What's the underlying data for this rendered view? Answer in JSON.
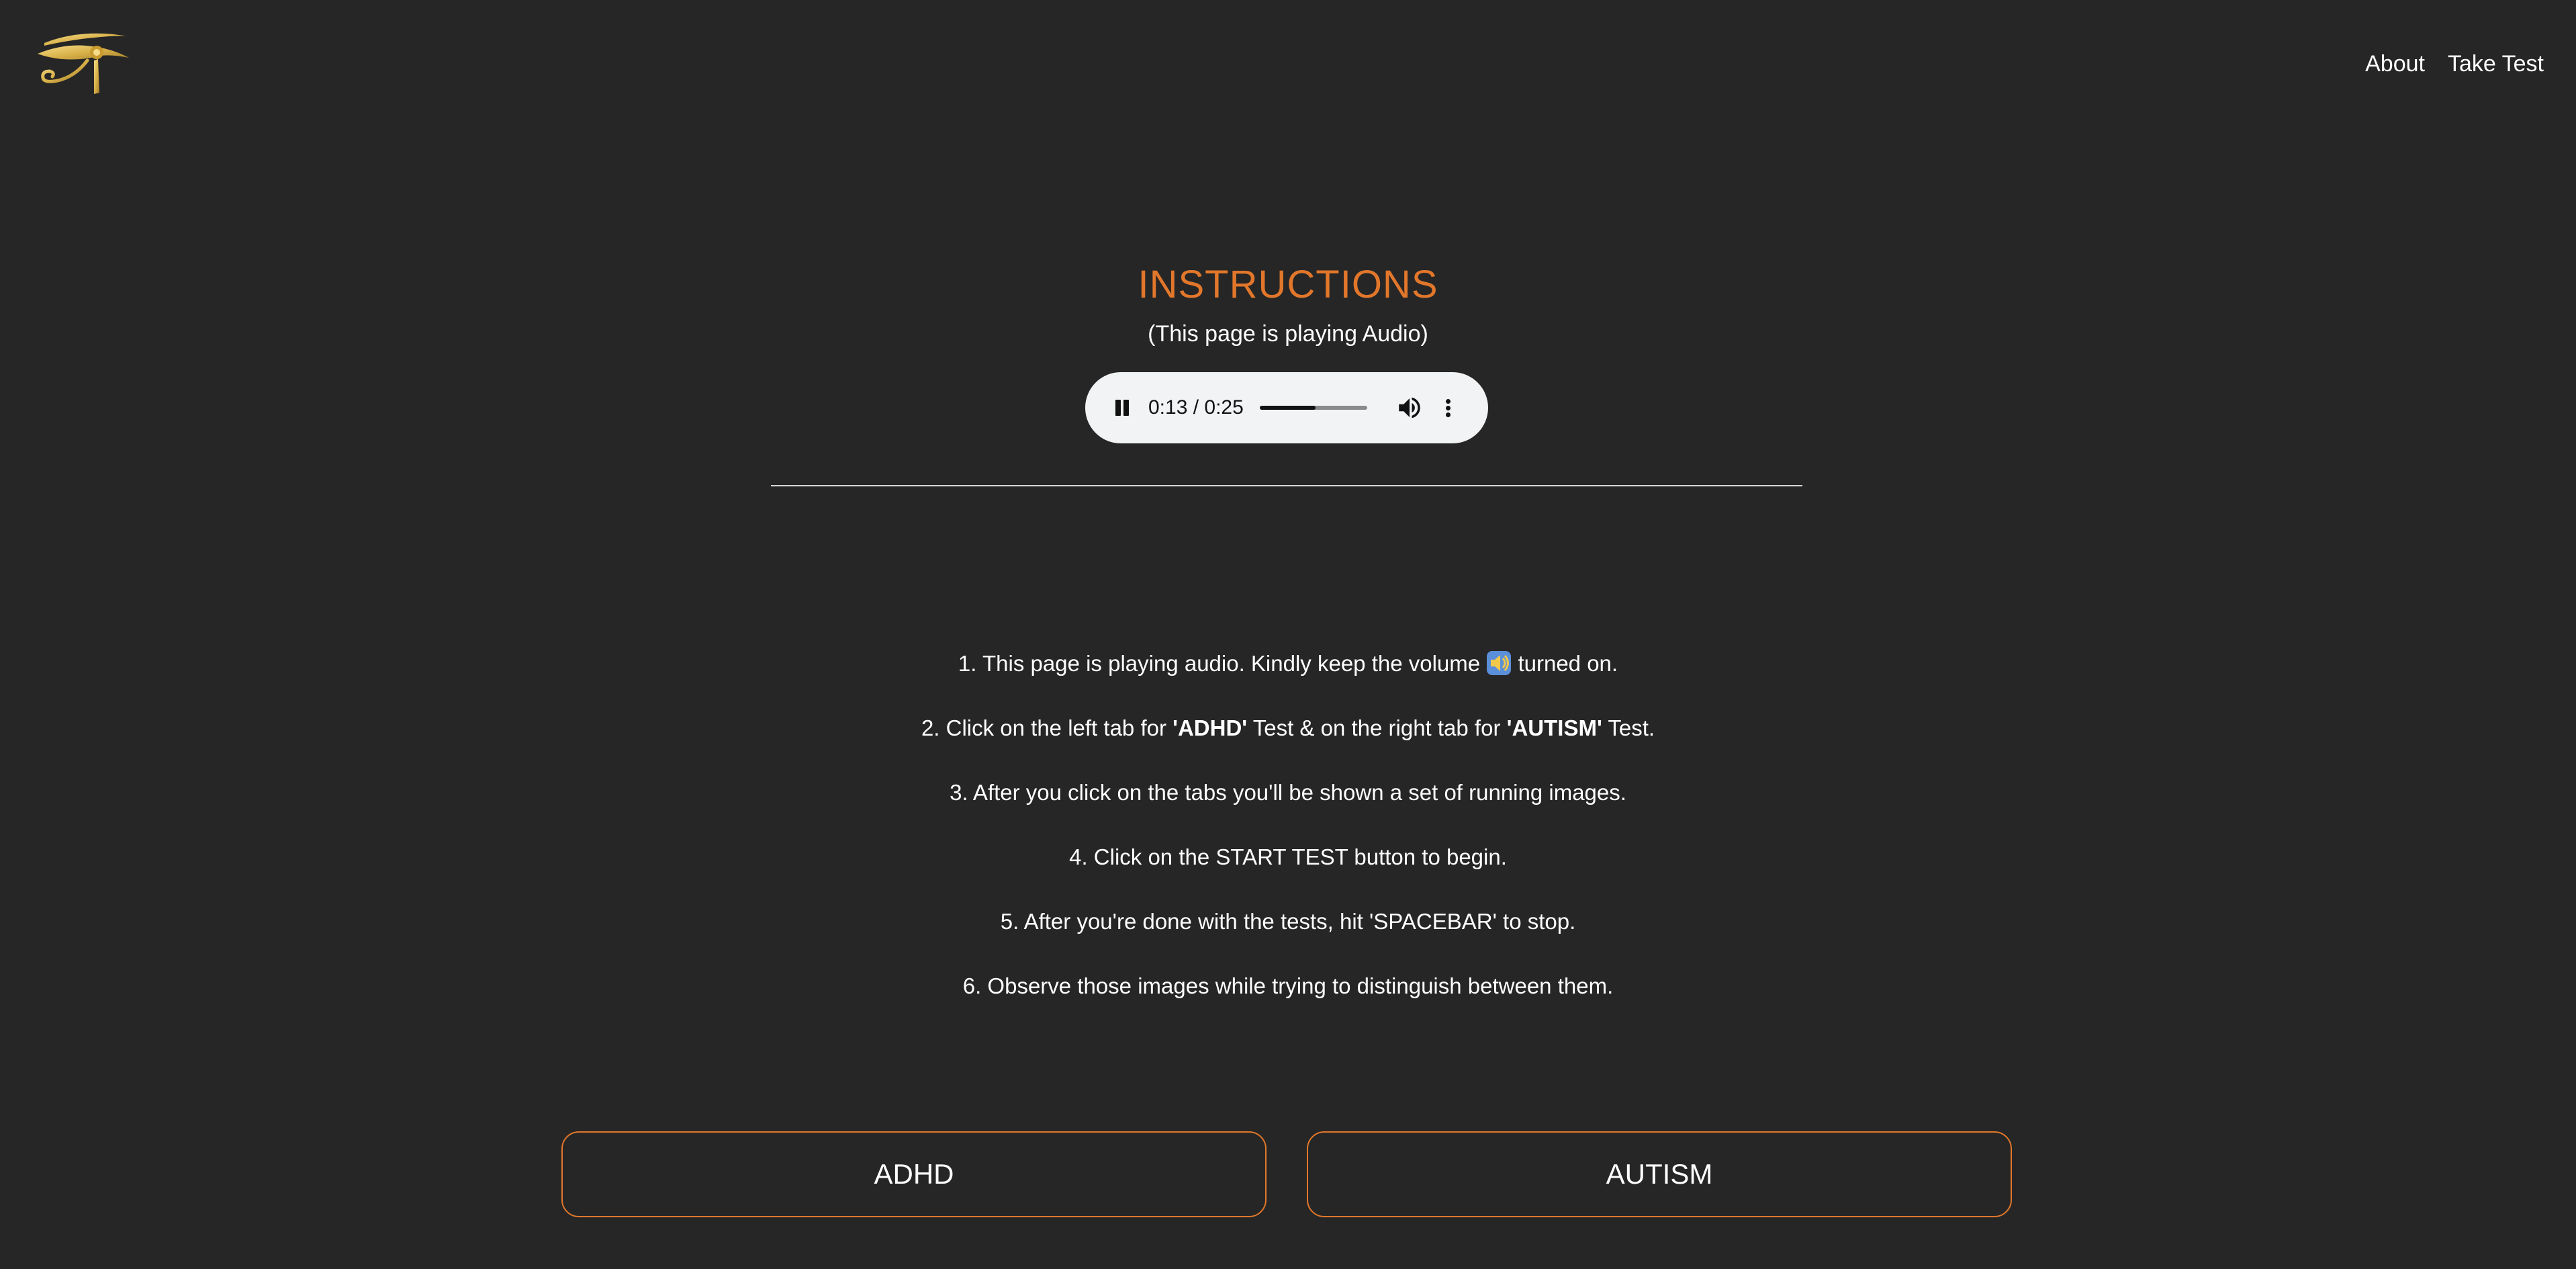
{
  "header": {
    "logo_icon": "eye-of-horus-icon",
    "nav": [
      {
        "label": "About"
      },
      {
        "label": "Take Test"
      }
    ]
  },
  "main": {
    "title": "INSTRUCTIONS",
    "subtitle": "(This page is playing Audio)",
    "audio_player": {
      "time_display": "0:13 / 0:25",
      "current_time": "0:13",
      "duration": "0:25",
      "progress_fraction": 0.52,
      "play_state_icon": "pause-icon",
      "volume_icon": "volume-icon",
      "menu_icon": "more-vertical-icon"
    },
    "instructions": {
      "line1_before": "1. This page is playing audio. Kindly keep the volume ",
      "line1_icon": "speaker-volume-icon",
      "line1_after": " turned on.",
      "line2_part1": "2. Click on the left tab for ",
      "line2_bold1": "'ADHD'",
      "line2_part2": " Test & on the right tab for ",
      "line2_bold2": "'AUTISM'",
      "line2_part3": " Test.",
      "line3": "3. After you click on the tabs you'll be shown a set of running images.",
      "line4": "4. Click on the START TEST button to begin.",
      "line5": "5. After you're done with the tests, hit 'SPACEBAR' to stop.",
      "line6": "6. Observe those images while trying to distinguish between them."
    },
    "buttons": {
      "adhd": "ADHD",
      "autism": "AUTISM"
    }
  },
  "colors": {
    "background": "#262626",
    "accent": "#e2772b",
    "text": "#ffffff",
    "player_bg": "#f1f3f4"
  }
}
